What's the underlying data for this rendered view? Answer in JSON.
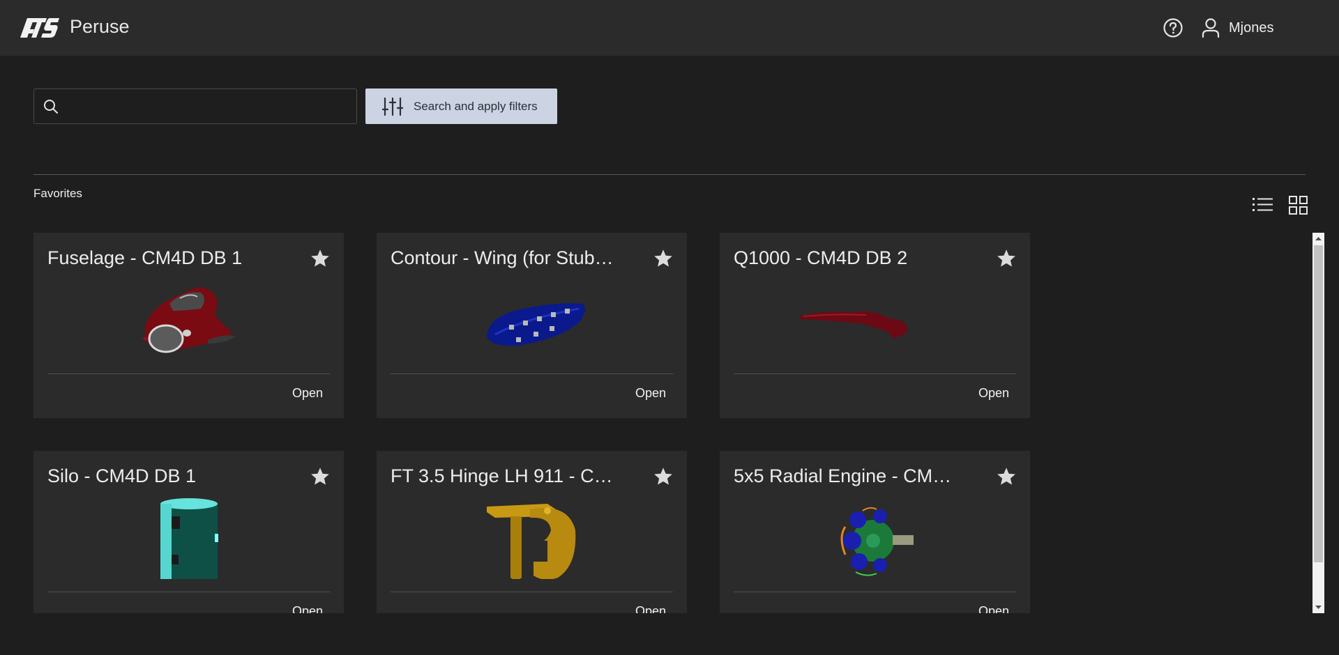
{
  "header": {
    "app_name": "Peruse",
    "user_name": "Mjones"
  },
  "search": {
    "placeholder": "",
    "value": "",
    "filter_button_label": "Search and apply filters"
  },
  "section": {
    "title": "Favorites"
  },
  "cards": [
    {
      "title": "Fuselage - CM4D DB 1",
      "action": "Open",
      "favorited": true
    },
    {
      "title": "Contour - Wing (for Stub…",
      "action": "Open",
      "favorited": true
    },
    {
      "title": "Q1000 - CM4D DB 2",
      "action": "Open",
      "favorited": true
    },
    {
      "title": "Silo - CM4D DB 1",
      "action": "Open",
      "favorited": true
    },
    {
      "title": "FT 3.5 Hinge LH 911 - C…",
      "action": "Open",
      "favorited": true
    },
    {
      "title": "5x5 Radial Engine - CM…",
      "action": "Open",
      "favorited": true
    }
  ],
  "icons": {
    "logo": "ats-logo",
    "help": "help-circle-icon",
    "user": "user-icon",
    "search": "search-icon",
    "filters": "sliders-icon",
    "star": "star-icon",
    "list_view": "list-view-icon",
    "grid_view": "grid-view-icon"
  },
  "colors": {
    "background": "#1e1e1e",
    "header": "#2b2b2b",
    "card": "#2b2b2b",
    "filter_button": "#ccd3e2"
  }
}
